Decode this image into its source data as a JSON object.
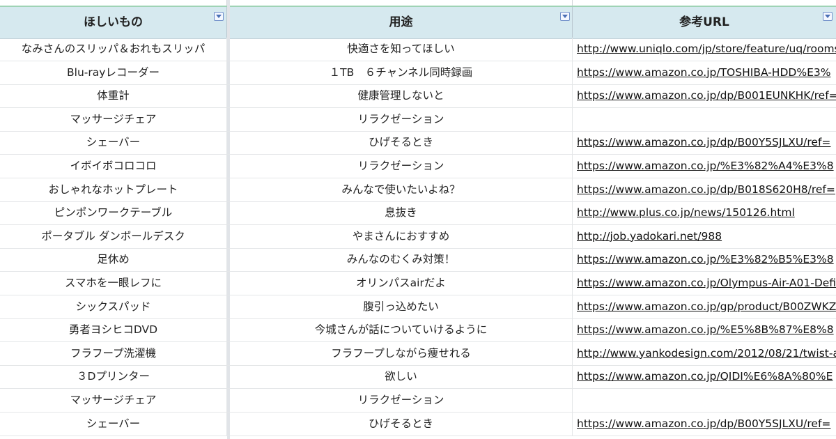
{
  "columns": {
    "want": "ほしいもの",
    "purpose": "用途",
    "url": "参考URL"
  },
  "icons": {
    "filter": "filter-dropdown-icon"
  },
  "colors": {
    "header_bg": "#d6e9ef",
    "header_top_border": "#9fd3b5",
    "filter_border": "#6f8fc9"
  },
  "rows": [
    {
      "want": "なみさんのスリッパ＆おれもスリッパ",
      "purpose": "快適さを知ってほしい",
      "url": "http://www.uniqlo.com/jp/store/feature/uq/roomsh"
    },
    {
      "want": "Blu-rayレコーダー",
      "purpose": "１TB　６チャンネル同時録画",
      "url": "https://www.amazon.co.jp/TOSHIBA-HDD%E3%"
    },
    {
      "want": "体重計",
      "purpose": "健康管理しないと",
      "url": "https://www.amazon.co.jp/dp/B001EUNKHK/ref="
    },
    {
      "want": "マッサージチェア",
      "purpose": "リラクゼーション",
      "url": ""
    },
    {
      "want": "シェーバー",
      "purpose": "ひげそるとき",
      "url": "https://www.amazon.co.jp/dp/B00Y5SJLXU/ref="
    },
    {
      "want": "イボイボコロコロ",
      "purpose": "リラクゼーション",
      "url": "https://www.amazon.co.jp/%E3%82%A4%E3%8"
    },
    {
      "want": "おしゃれなホットプレート",
      "purpose": "みんなで使いたいよね？",
      "url": "https://www.amazon.co.jp/dp/B018S620H8/ref="
    },
    {
      "want": "ピンポンワークテーブル",
      "purpose": "息抜き",
      "url": "http://www.plus.co.jp/news/150126.html"
    },
    {
      "want": "ポータブル ダンボールデスク",
      "purpose": "やまさんにおすすめ",
      "url": "http://job.yadokari.net/988"
    },
    {
      "want": "足休め",
      "purpose": "みんなのむくみ対策！",
      "url": "https://www.amazon.co.jp/%E3%82%B5%E3%8"
    },
    {
      "want": "スマホを一眼レフに",
      "purpose": "オリンパスairだよ",
      "url": "https://www.amazon.co.jp/Olympus-Air-A01-Defi"
    },
    {
      "want": "シックスパッド",
      "purpose": "腹引っ込めたい",
      "url": "https://www.amazon.co.jp/gp/product/B00ZWKZ"
    },
    {
      "want": "勇者ヨシヒコDVD",
      "purpose": "今城さんが話についていけるように",
      "url": "https://www.amazon.co.jp/%E5%8B%87%E8%8"
    },
    {
      "want": "フラフープ洗濯機",
      "purpose": "フラフープしながら痩せれる",
      "url": "http://www.yankodesign.com/2012/08/21/twist-ar"
    },
    {
      "want": "３Dプリンター",
      "purpose": "欲しい",
      "url": "https://www.amazon.co.jp/QIDI%E6%8A%80%E"
    },
    {
      "want": "マッサージチェア",
      "purpose": "リラクゼーション",
      "url": ""
    },
    {
      "want": "シェーバー",
      "purpose": "ひげそるとき",
      "url": "https://www.amazon.co.jp/dp/B00Y5SJLXU/ref="
    }
  ]
}
